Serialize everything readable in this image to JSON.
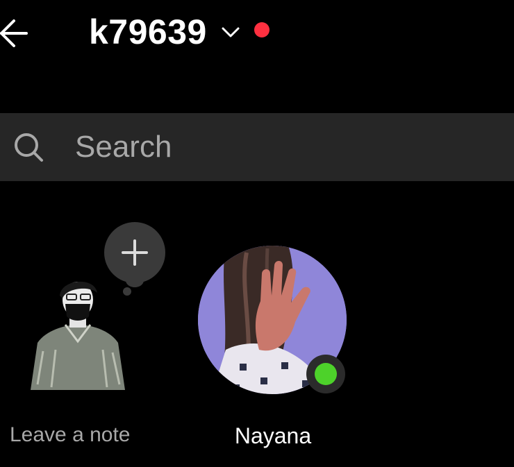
{
  "header": {
    "username": "k79639",
    "back_icon": "back-arrow-icon",
    "dropdown_icon": "chevron-down-icon",
    "notification_color": "#ff3040"
  },
  "search": {
    "placeholder": "Search",
    "icon": "search-icon"
  },
  "notes": {
    "self": {
      "label": "Leave a note",
      "add_icon": "plus-icon"
    },
    "friends": [
      {
        "name": "Nayana",
        "online": true,
        "online_color": "#4dd22a"
      }
    ]
  }
}
